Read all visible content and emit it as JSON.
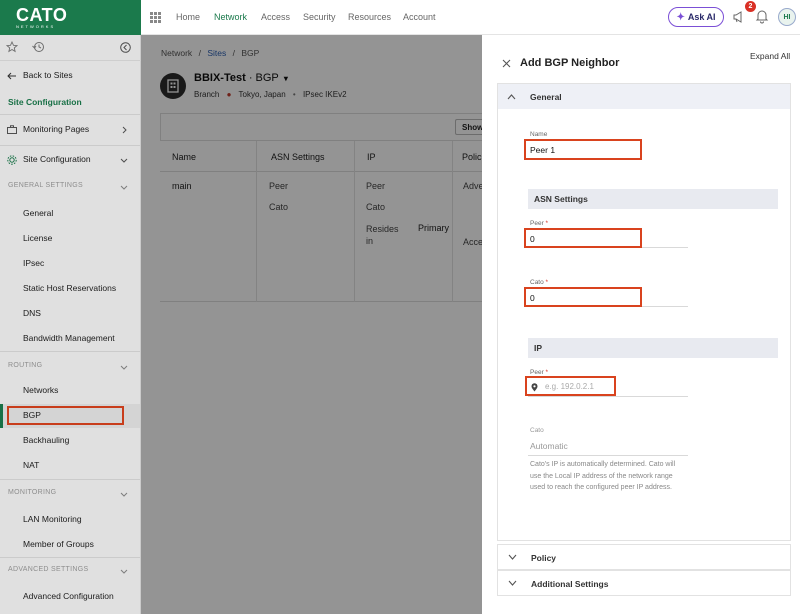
{
  "header": {
    "logo_text": "CATO",
    "logo_sub": "NETWORKS",
    "nav": [
      "Home",
      "Network",
      "Access",
      "Security",
      "Resources",
      "Account"
    ],
    "active_nav": "Network",
    "ask_ai": "Ask AI",
    "notif_count": "2",
    "avatar_initials": "HI",
    "brand_color": "#1b7a4c",
    "accent_color": "#7b4fd6"
  },
  "sidebar": {
    "back": "Back to Sites",
    "site_config_label": "Site Configuration",
    "monitoring_pages": "Monitoring Pages",
    "site_configuration": "Site Configuration",
    "sec_general": "GENERAL SETTINGS",
    "general_items": [
      "General",
      "License",
      "IPsec",
      "Static Host Reservations",
      "DNS",
      "Bandwidth Management"
    ],
    "sec_routing": "ROUTING",
    "routing_items": [
      "Networks",
      "BGP",
      "Backhauling",
      "NAT"
    ],
    "sec_monitoring": "MONITORING",
    "monitoring_items": [
      "LAN Monitoring",
      "Member of Groups"
    ],
    "sec_advanced": "ADVANCED SETTINGS",
    "advanced_items": [
      "Advanced Configuration"
    ]
  },
  "page": {
    "breadcrumb": [
      "Network",
      "Sites",
      "BGP"
    ],
    "site_name": "BBIX-Test",
    "site_suffix": "· BGP",
    "site_type": "Branch",
    "site_location": "Tokyo, Japan",
    "site_conn": "IPsec IKEv2",
    "show_button": "Show",
    "columns": [
      "Name",
      "ASN Settings",
      "IP",
      "Polic"
    ],
    "row": {
      "name": "main",
      "asn_peer_label": "Peer",
      "asn_cato_label": "Cato",
      "ip_peer_label": "Peer",
      "ip_cato_label": "Cato",
      "resides_label": "Resides in",
      "resides_value": "Primary",
      "policy_1": "Adve",
      "policy_2": "Acce"
    }
  },
  "drawer": {
    "title": "Add BGP Neighbor",
    "expand_all": "Expand All",
    "general": "General",
    "name_label": "Name",
    "name_value": "Peer 1",
    "asn_section": "ASN Settings",
    "peer_label": "Peer",
    "peer_value": "0",
    "cato_label": "Cato",
    "cato_value": "0",
    "ip_section": "IP",
    "ip_peer_label": "Peer",
    "ip_peer_placeholder": "e.g. 192.0.2.1",
    "ip_cato_label": "Cato",
    "ip_cato_value": "Automatic",
    "ip_cato_help": "Cato's IP is automatically determined. Cato will use the Local IP address of the network range used to reach the configured peer IP address.",
    "required_mark": "*",
    "policy": "Policy",
    "additional": "Additional Settings"
  }
}
